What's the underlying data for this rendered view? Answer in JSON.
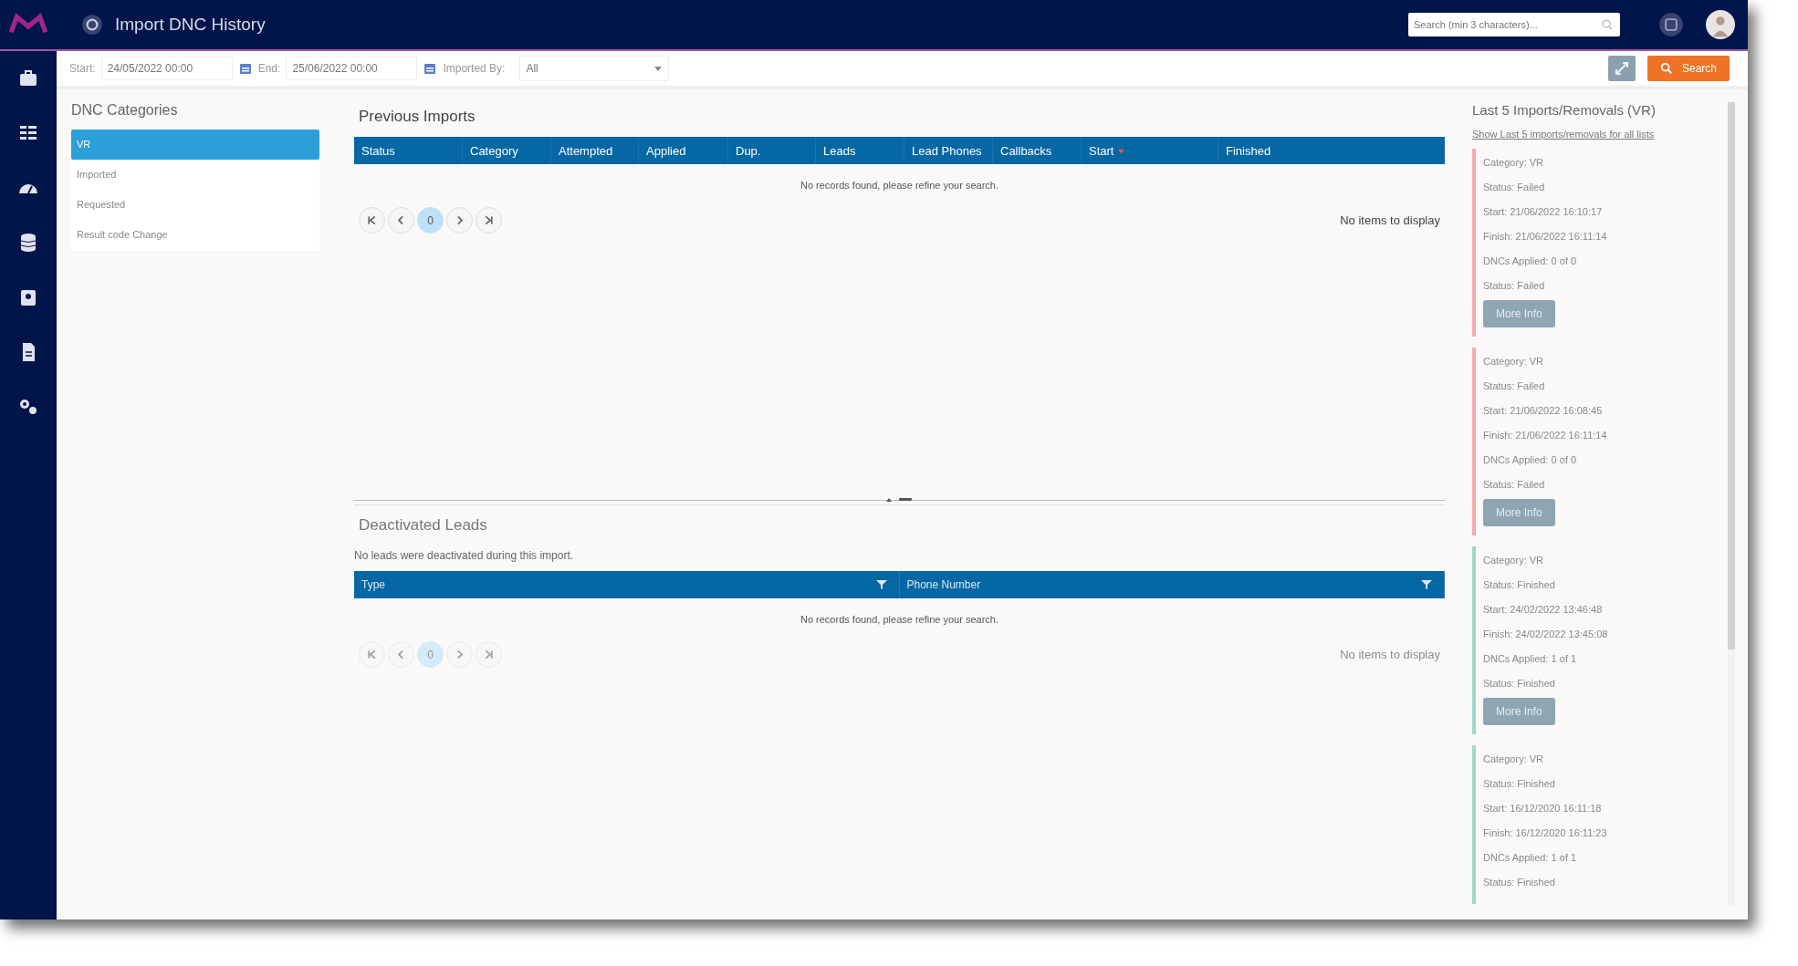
{
  "app_bar": {
    "title": "Import DNC History",
    "search": {
      "placeholder": "Search (min 3 characters)..."
    }
  },
  "filters": {
    "start_label": "Start:",
    "start": "24/05/2022 00:00",
    "end_label": "End:",
    "end": "25/06/2022 00:00",
    "imported_by_label": "Imported By:",
    "imported_by": "All",
    "search_button": "Search"
  },
  "categories": {
    "title": "DNC Categories",
    "items": [
      {
        "label": "VR",
        "selected": true
      },
      {
        "label": "Imported",
        "selected": false
      },
      {
        "label": "Requested",
        "selected": false
      },
      {
        "label": "Result code Change",
        "selected": false
      }
    ]
  },
  "previous_imports": {
    "title": "Previous Imports",
    "columns": [
      {
        "label": "Status",
        "sorted": false
      },
      {
        "label": "Category",
        "sorted": false
      },
      {
        "label": "Attempted",
        "sorted": false
      },
      {
        "label": "Applied",
        "sorted": false
      },
      {
        "label": "Dup.",
        "sorted": false
      },
      {
        "label": "Leads",
        "sorted": false
      },
      {
        "label": "Lead Phones",
        "sorted": false
      },
      {
        "label": "Callbacks",
        "sorted": false
      },
      {
        "label": "Start",
        "sorted": true
      },
      {
        "label": "Finished",
        "sorted": false
      }
    ],
    "empty": "No records found, please refine your search.",
    "pager": {
      "page": "0",
      "summary": "No items to display"
    }
  },
  "deactivated_leads": {
    "title": "Deactivated Leads",
    "note": "No leads were deactivated during this import.",
    "columns": [
      "Type",
      "Phone Number"
    ],
    "empty": "No records found, please refine your search.",
    "pager": {
      "page": "0",
      "summary": "No items to display"
    }
  },
  "recent": {
    "title": "Last 5 Imports/Removals (VR)",
    "link": "Show Last 5 imports/removals for all lists",
    "cards": [
      {
        "kind": "failed",
        "lines": [
          "Category: VR",
          "Status: Failed",
          "Start: 21/06/2022 16:10:17",
          "Finish: 21/06/2022 16:11:14",
          "DNCs Applied: 0 of 0",
          "Status: Failed"
        ],
        "button": "More Info"
      },
      {
        "kind": "failed",
        "lines": [
          "Category: VR",
          "Status: Failed",
          "Start: 21/06/2022 16:08:45",
          "Finish: 21/06/2022 16:11:14",
          "DNCs Applied: 0 of 0",
          "Status: Failed"
        ],
        "button": "More Info"
      },
      {
        "kind": "finished",
        "lines": [
          "Category: VR",
          "Status: Finished",
          "Start: 24/02/2022 13:46:48",
          "Finish: 24/02/2022 13:45:08",
          "DNCs Applied: 1 of 1",
          "Status: Finished"
        ],
        "button": "More Info"
      },
      {
        "kind": "finished",
        "lines": [
          "Category: VR",
          "Status: Finished",
          "Start: 16/12/2020 16:11:18",
          "Finish: 16/12/2020 16:11:23",
          "DNCs Applied: 1 of 1",
          "Status: Finished"
        ]
      }
    ]
  }
}
